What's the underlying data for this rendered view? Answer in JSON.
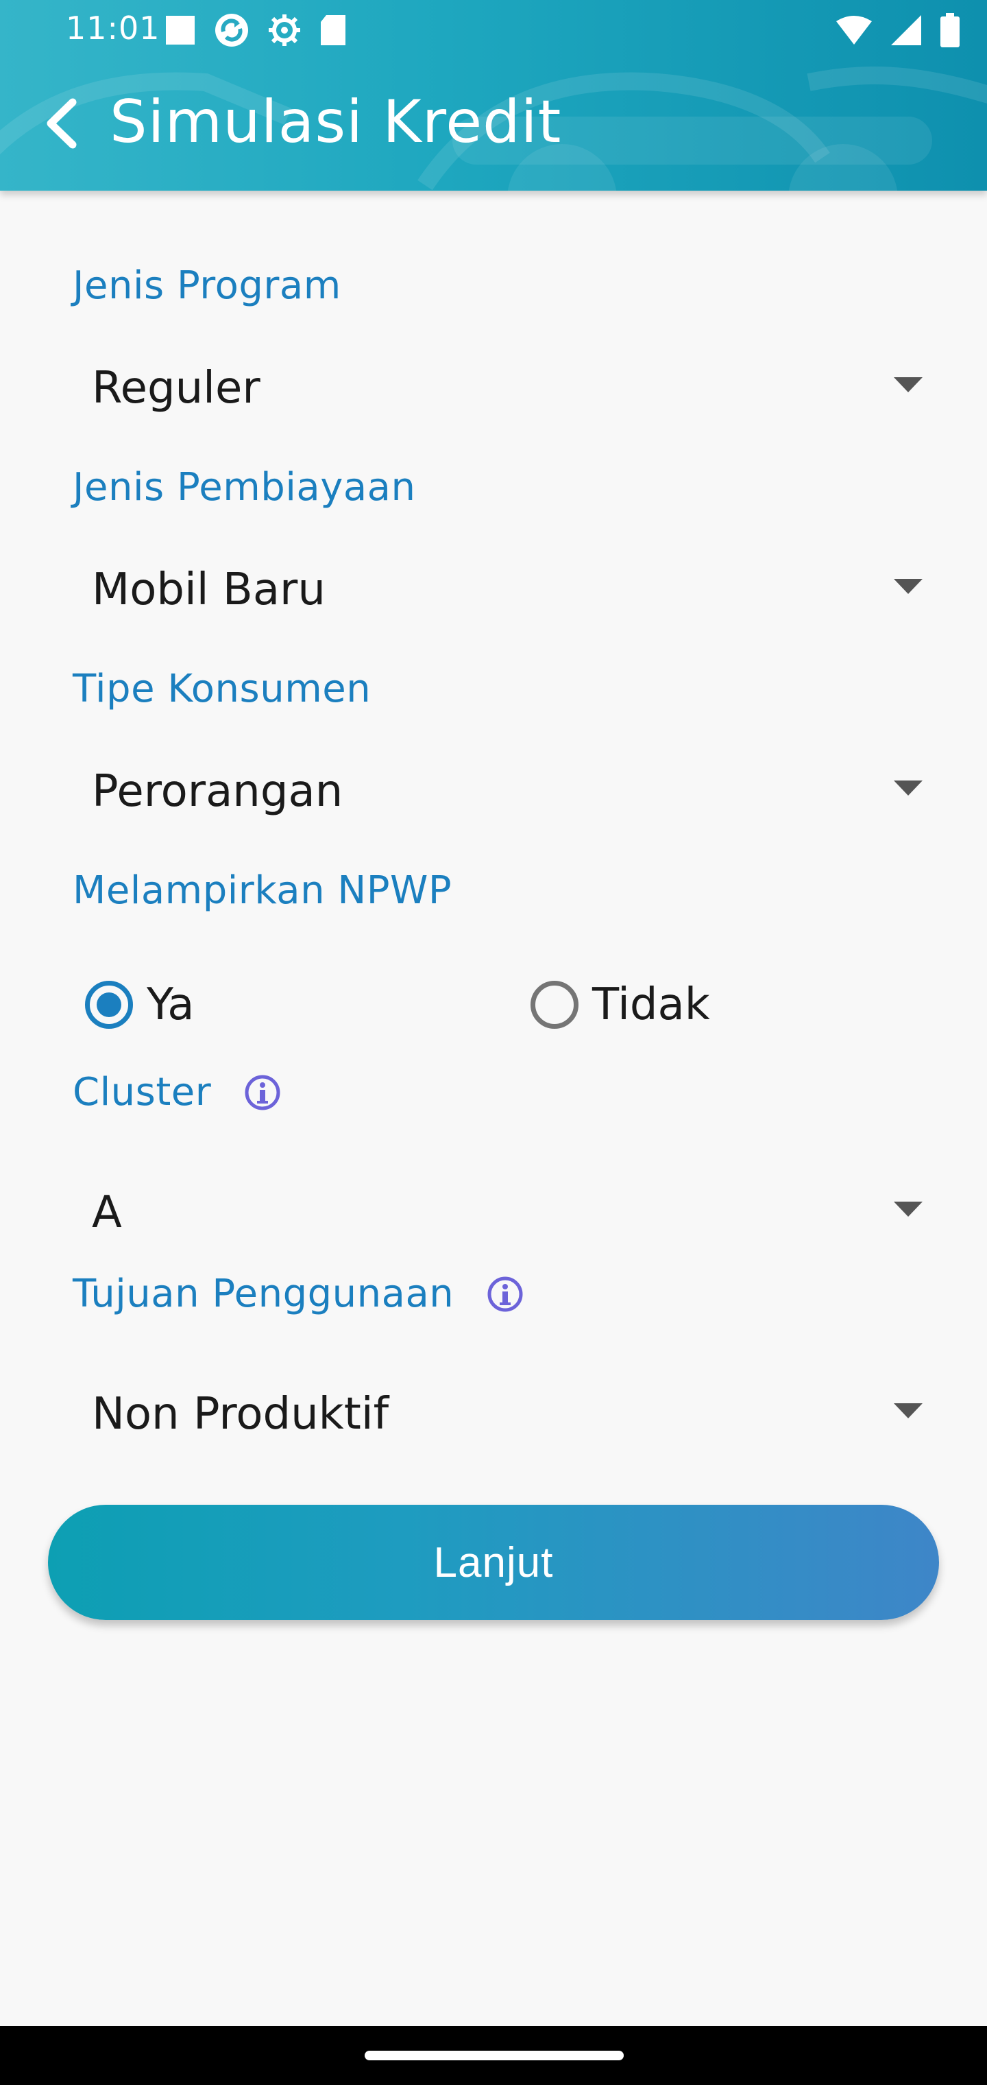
{
  "status_bar": {
    "time": "11:01",
    "left_icons": [
      "notification-square-icon",
      "sync-icon",
      "settings-icon",
      "sd-card-icon"
    ],
    "right_icons": [
      "wifi-icon",
      "signal-icon",
      "battery-icon"
    ]
  },
  "app_bar": {
    "title": "Simulasi Kredit",
    "back_icon": "arrow-back-icon"
  },
  "form": {
    "jenis_program": {
      "label": "Jenis Program",
      "value": "Reguler"
    },
    "jenis_pembiayaan": {
      "label": "Jenis Pembiayaan",
      "value": "Mobil Baru"
    },
    "tipe_konsumen": {
      "label": "Tipe Konsumen",
      "value": "Perorangan"
    },
    "npwp": {
      "label": "Melampirkan NPWP",
      "options": [
        {
          "label": "Ya",
          "checked": true
        },
        {
          "label": "Tidak",
          "checked": false
        }
      ]
    },
    "cluster": {
      "label": "Cluster",
      "value": "A",
      "info_icon": "info-icon"
    },
    "tujuan_penggunaan": {
      "label": "Tujuan Penggunaan",
      "value": "Non Produktif",
      "info_icon": "info-icon"
    }
  },
  "submit": {
    "label": "Lanjut"
  },
  "colors": {
    "accent": "#1b7fbf",
    "header_start": "#35b5c9",
    "header_end": "#0e90ae",
    "button_start": "#0d9fb3",
    "button_end": "#3e86c8",
    "background": "#f8f8f8"
  }
}
